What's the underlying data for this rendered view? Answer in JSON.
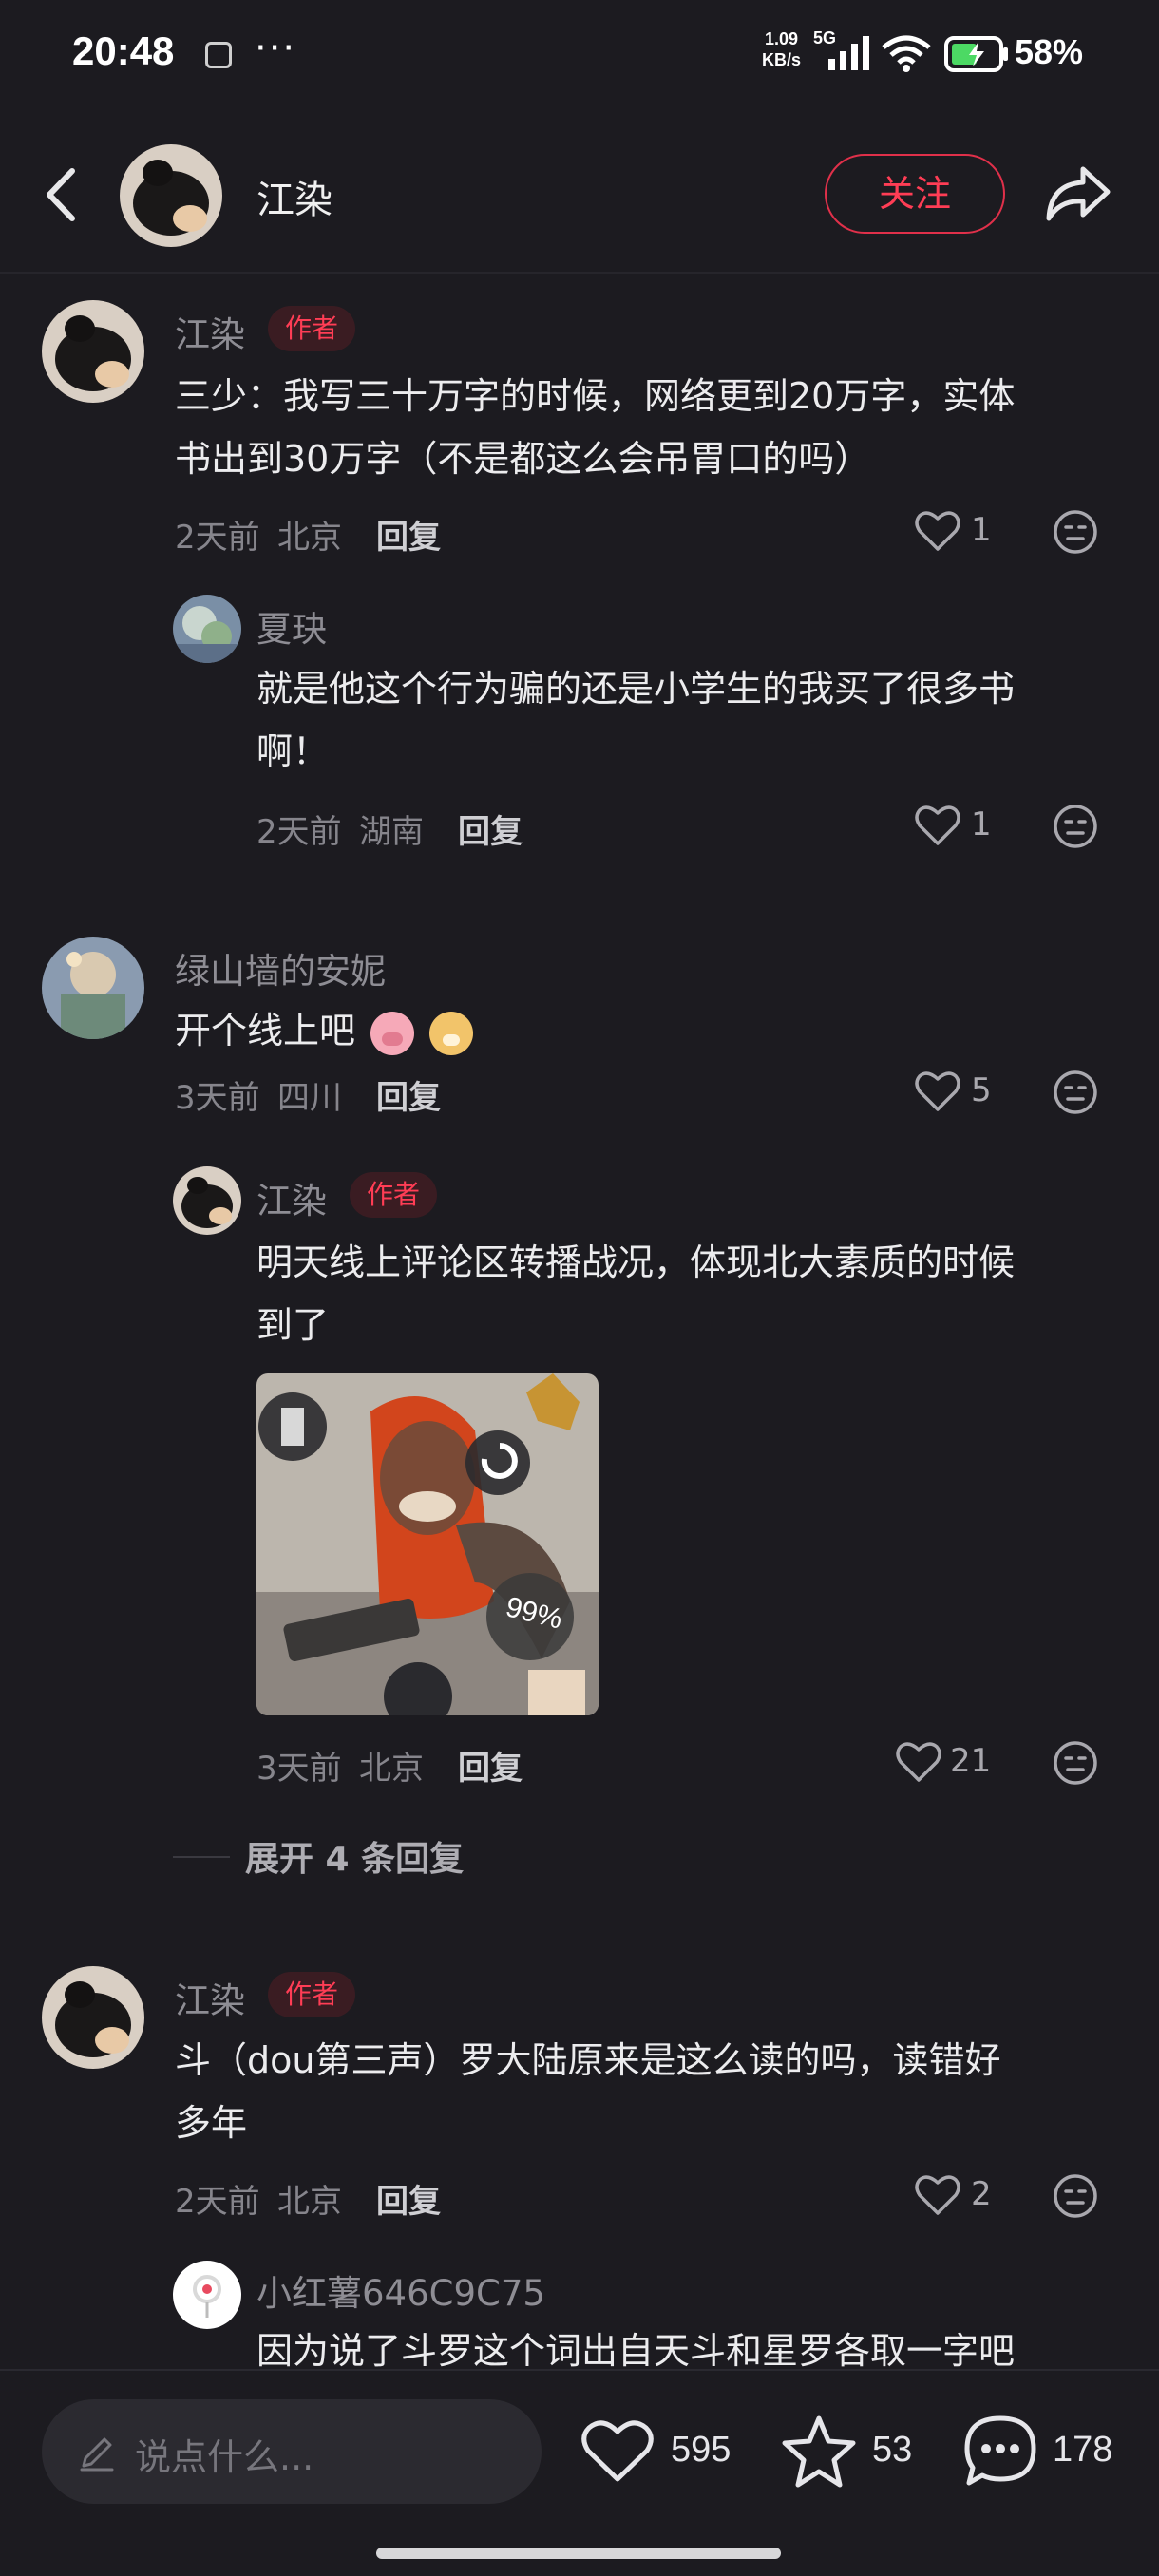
{
  "status_bar": {
    "time": "20:48",
    "net_speed_value": "1.09",
    "net_speed_unit": "KB/s",
    "network_type": "5G",
    "battery": "58%"
  },
  "header": {
    "username": "江染",
    "follow_label": "关注"
  },
  "comments": [
    {
      "username": "江染",
      "tag": "作者",
      "text_line1": "三少：我写三十万字的时候，网络更到20万字，实体",
      "text_line2": "书出到30万字（不是都这么会吊胃口的吗）",
      "time": "2天前",
      "location": "北京",
      "reply_label": "回复",
      "likes": "1"
    },
    {
      "username": "夏玦",
      "text_line1": "就是他这个行为骗的还是小学生的我买了很多书",
      "text_line2": "啊！",
      "time": "2天前",
      "location": "湖南",
      "reply_label": "回复",
      "likes": "1"
    },
    {
      "username": "绿山墙的安妮",
      "text_line1": "开个线上吧",
      "time": "3天前",
      "location": "四川",
      "reply_label": "回复",
      "likes": "5"
    },
    {
      "username": "江染",
      "tag": "作者",
      "text_line1": "明天线上评论区转播战况，体现北大素质的时候",
      "text_line2": "到了",
      "image_badge": "99%",
      "time": "3天前",
      "location": "北京",
      "reply_label": "回复",
      "likes": "21"
    },
    {
      "username": "江染",
      "tag": "作者",
      "text_line1": "斗（dou第三声）罗大陆原来是这么读的吗，读错好",
      "text_line2": "多年",
      "time": "2天前",
      "location": "北京",
      "reply_label": "回复",
      "likes": "2"
    },
    {
      "username": "小红薯646C9C75",
      "text_line1": "因为说了斗罗这个词出自天斗和星罗各取一字吧"
    }
  ],
  "expand_replies": "展开 4 条回复",
  "bottom_bar": {
    "input_placeholder": "说点什么...",
    "likes": "595",
    "favorites": "53",
    "comments": "178"
  },
  "colors": {
    "background": "#1c1b20",
    "accent_red": "#ff3d55",
    "text_primary": "#ececee",
    "text_secondary": "#8e8d94"
  }
}
